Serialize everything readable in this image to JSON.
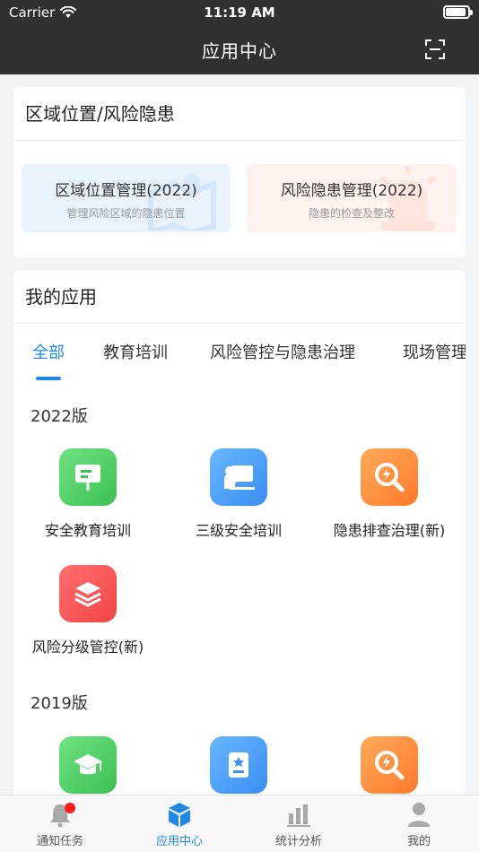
{
  "status_bar": {
    "carrier": "Carrier",
    "time": "11:19 AM"
  },
  "header": {
    "title": "应用中心",
    "scan_icon": "scan-icon"
  },
  "region_card": {
    "title": "区域位置/风险隐患",
    "tiles": [
      {
        "title": "区域位置管理(2022)",
        "subtitle": "管理风险区域的隐患位置",
        "color": "#e9f3fe"
      },
      {
        "title": "风险隐患管理(2022)",
        "subtitle": "隐患的检查及整改",
        "color": "#fff2ef"
      }
    ]
  },
  "apps_card": {
    "title": "我的应用",
    "tabs": [
      "全部",
      "教育培训",
      "风险管控与隐患治理",
      "现场管理"
    ],
    "active_tab": "全部",
    "accent": "#1e88e5",
    "sections": [
      {
        "label": "2022版",
        "apps": [
          {
            "label": "安全教育培训",
            "icon": "presentation-board-icon",
            "color": "green"
          },
          {
            "label": "三级安全培训",
            "icon": "teacher-board-icon",
            "color": "blue"
          },
          {
            "label": "隐患排查治理(新)",
            "icon": "magnifier-alert-icon",
            "color": "orange"
          },
          {
            "label": "风险分级管控(新)",
            "icon": "layers-icon",
            "color": "red"
          }
        ]
      },
      {
        "label": "2019版",
        "apps": [
          {
            "label": "",
            "icon": "graduation-cap-icon",
            "color": "green"
          },
          {
            "label": "",
            "icon": "document-badge-icon",
            "color": "blue"
          },
          {
            "label": "",
            "icon": "magnifier-alert-icon",
            "color": "orange"
          }
        ]
      }
    ]
  },
  "tabbar": {
    "items": [
      {
        "label": "通知任务",
        "icon": "bell-icon",
        "badge": true
      },
      {
        "label": "应用中心",
        "icon": "cube-icon",
        "active": true
      },
      {
        "label": "统计分析",
        "icon": "bar-chart-icon"
      },
      {
        "label": "我的",
        "icon": "person-icon"
      }
    ]
  }
}
